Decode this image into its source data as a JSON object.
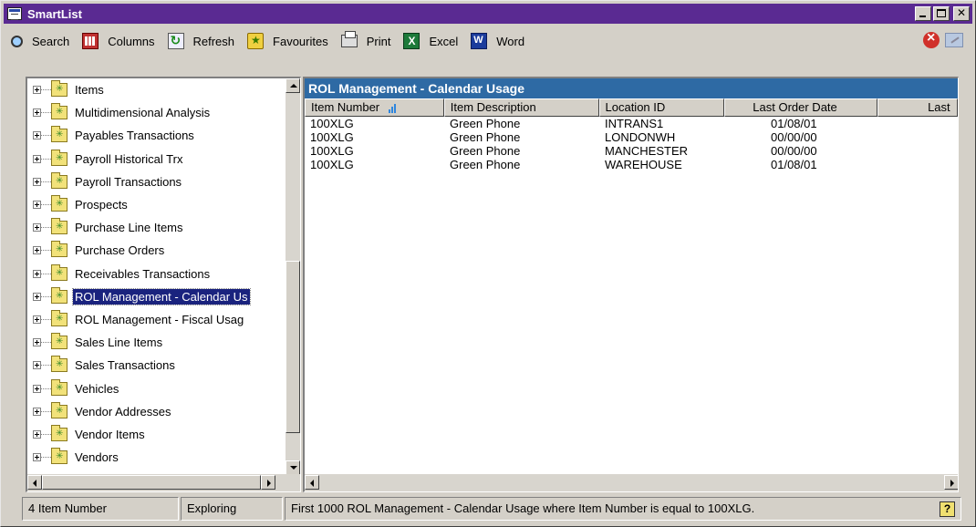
{
  "window": {
    "title": "SmartList"
  },
  "toolbar": {
    "items": [
      {
        "label": "Search",
        "icon": "search-icon"
      },
      {
        "label": "Columns",
        "icon": "columns-icon"
      },
      {
        "label": "Refresh",
        "icon": "refresh-icon"
      },
      {
        "label": "Favourites",
        "icon": "favourites-icon"
      },
      {
        "label": "Print",
        "icon": "print-icon"
      },
      {
        "label": "Excel",
        "icon": "excel-icon"
      },
      {
        "label": "Word",
        "icon": "word-icon"
      }
    ],
    "right_icons": [
      "stop-icon",
      "edit-icon"
    ]
  },
  "tree": {
    "items": [
      {
        "label": "Items"
      },
      {
        "label": "Multidimensional Analysis"
      },
      {
        "label": "Payables Transactions"
      },
      {
        "label": "Payroll Historical Trx"
      },
      {
        "label": "Payroll Transactions"
      },
      {
        "label": "Prospects"
      },
      {
        "label": "Purchase Line Items"
      },
      {
        "label": "Purchase Orders"
      },
      {
        "label": "Receivables Transactions"
      },
      {
        "label": "ROL Management - Calendar Us",
        "selected": true
      },
      {
        "label": "ROL Management - Fiscal Usag"
      },
      {
        "label": "Sales Line Items"
      },
      {
        "label": "Sales Transactions"
      },
      {
        "label": "Vehicles"
      },
      {
        "label": "Vendor Addresses"
      },
      {
        "label": "Vendor Items"
      },
      {
        "label": "Vendors"
      }
    ]
  },
  "results": {
    "title": "ROL Management - Calendar Usage",
    "columns": [
      "Item Number",
      "Item Description",
      "Location ID",
      "Last Order Date",
      "Last"
    ],
    "rows": [
      [
        "100XLG",
        "Green Phone",
        "INTRANS1",
        "01/08/01"
      ],
      [
        "100XLG",
        "Green Phone",
        "LONDONWH",
        "00/00/00"
      ],
      [
        "100XLG",
        "Green Phone",
        "MANCHESTER",
        "00/00/00"
      ],
      [
        "100XLG",
        "Green Phone",
        "WAREHOUSE",
        "01/08/01"
      ]
    ]
  },
  "status": {
    "count": "4 Item Number",
    "mode": "Exploring",
    "message": "First 1000 ROL Management - Calendar Usage where Item Number is equal to 100XLG.",
    "help_icon": "help-icon"
  },
  "colors": {
    "title_bar": "#5a2a92",
    "results_header": "#2e6aa4",
    "selection": "#1a237e"
  }
}
